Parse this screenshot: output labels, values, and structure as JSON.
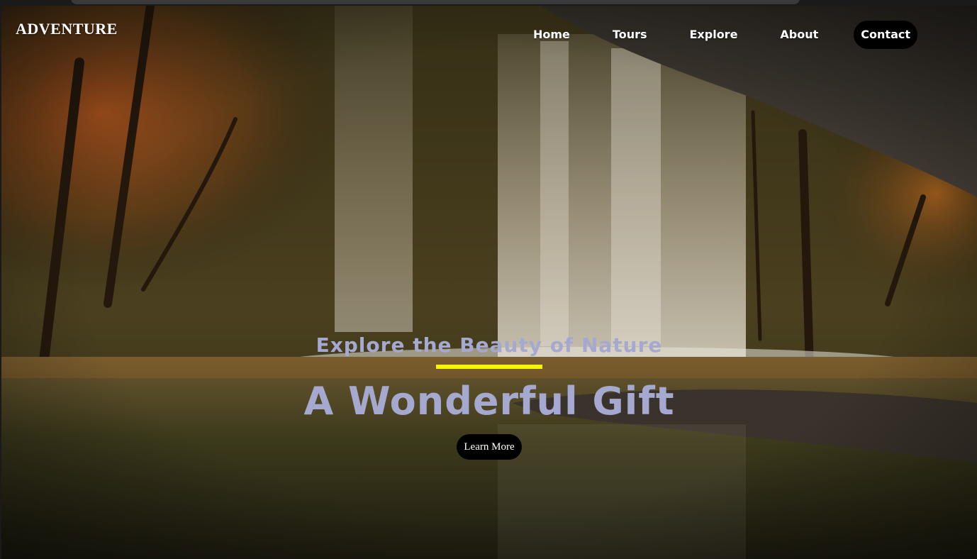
{
  "logo": {
    "text": "ADVENTURE"
  },
  "nav": {
    "items": [
      {
        "label": "Home"
      },
      {
        "label": "Tours"
      },
      {
        "label": "Explore"
      },
      {
        "label": "About"
      },
      {
        "label": "Contact"
      }
    ]
  },
  "hero": {
    "subtitle": "Explore the Beauty of Nature",
    "title": "A Wonderful Gift",
    "cta_label": "Learn More",
    "background": "waterfall-forest-photo"
  },
  "colors": {
    "heading_text": "#a6a9cf",
    "accent_underline": "#f5f500",
    "pill_bg": "#000000",
    "nav_text": "#ffffff"
  }
}
